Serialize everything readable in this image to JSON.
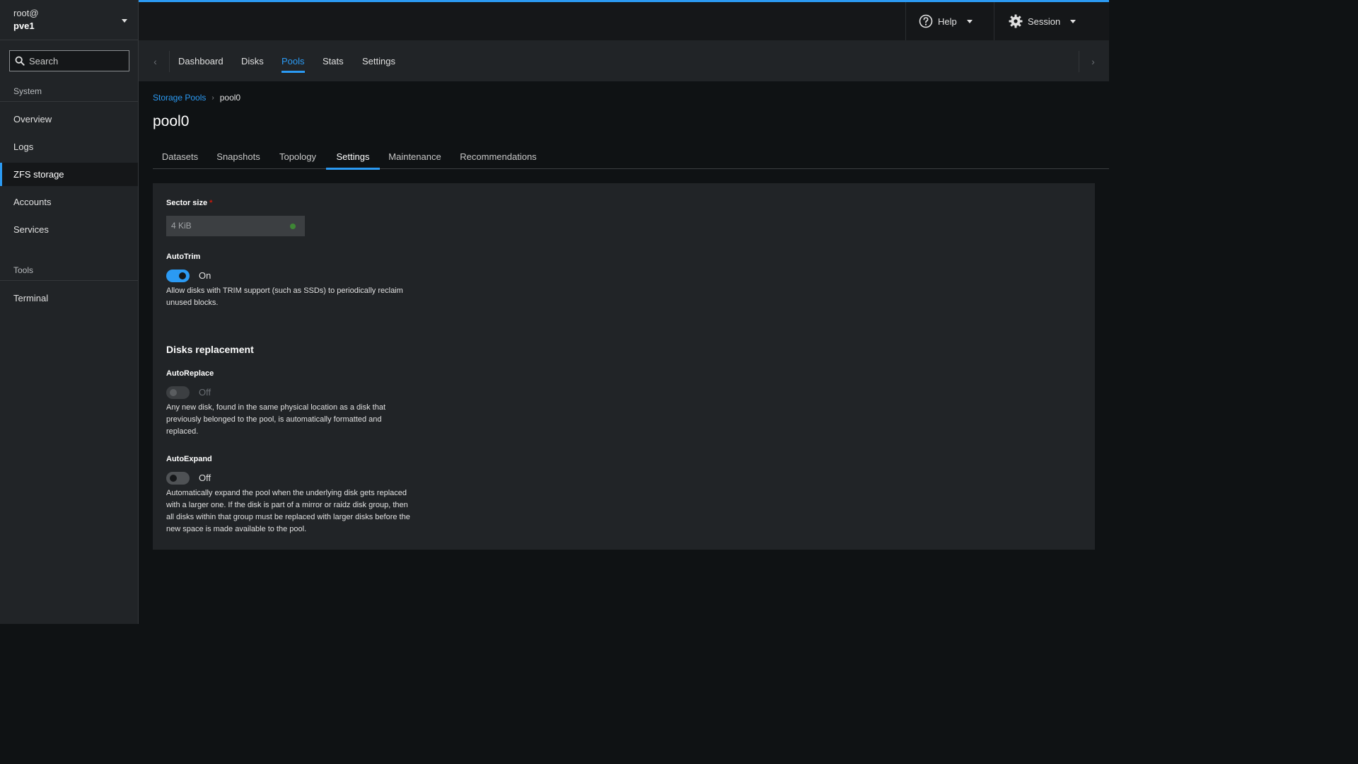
{
  "sidebar": {
    "host_user": "root@",
    "host_name": "pve1",
    "search_placeholder": "Search",
    "sections": [
      {
        "title": "System",
        "items": [
          "Overview",
          "Logs",
          "ZFS storage",
          "Accounts",
          "Services"
        ]
      },
      {
        "title": "Tools",
        "items": [
          "Terminal"
        ]
      }
    ],
    "active_item": "ZFS storage"
  },
  "topbar": {
    "help_label": "Help",
    "session_label": "Session"
  },
  "primary_tabs": {
    "items": [
      "Dashboard",
      "Disks",
      "Pools",
      "Stats",
      "Settings"
    ],
    "active": "Pools"
  },
  "breadcrumb": {
    "parent": "Storage Pools",
    "current": "pool0"
  },
  "page_title": "pool0",
  "secondary_tabs": {
    "items": [
      "Datasets",
      "Snapshots",
      "Topology",
      "Settings",
      "Maintenance",
      "Recommendations"
    ],
    "active": "Settings"
  },
  "settings": {
    "sector_size": {
      "label": "Sector size",
      "required_mark": "*",
      "value": "4 KiB"
    },
    "autotrim": {
      "label": "AutoTrim",
      "state": "On",
      "help_line1": "Allow disks with TRIM support (such as SSDs) to periodically reclaim",
      "help_line2": "unused blocks."
    },
    "disks_replacement_title": "Disks replacement",
    "autoreplace": {
      "label": "AutoReplace",
      "state": "Off",
      "help_line1": "Any new disk, found in the same physical location as a disk that",
      "help_line2": "previously belonged to the pool, is automatically formatted and",
      "help_line3": "replaced."
    },
    "autoexpand": {
      "label": "AutoExpand",
      "state": "Off",
      "help_line1": "Automatically expand the pool when the underlying disk gets replaced",
      "help_line2": "with a larger one. If the disk is part of a mirror or raidz disk group, then",
      "help_line3": "all disks within that group must be replaced with larger disks before the",
      "help_line4": "new space is made available to the pool."
    }
  },
  "colors": {
    "accent": "#2b9af3",
    "background": "#0f1214",
    "sidebar": "#212427",
    "success": "#3e8635",
    "required": "#c9190b"
  }
}
